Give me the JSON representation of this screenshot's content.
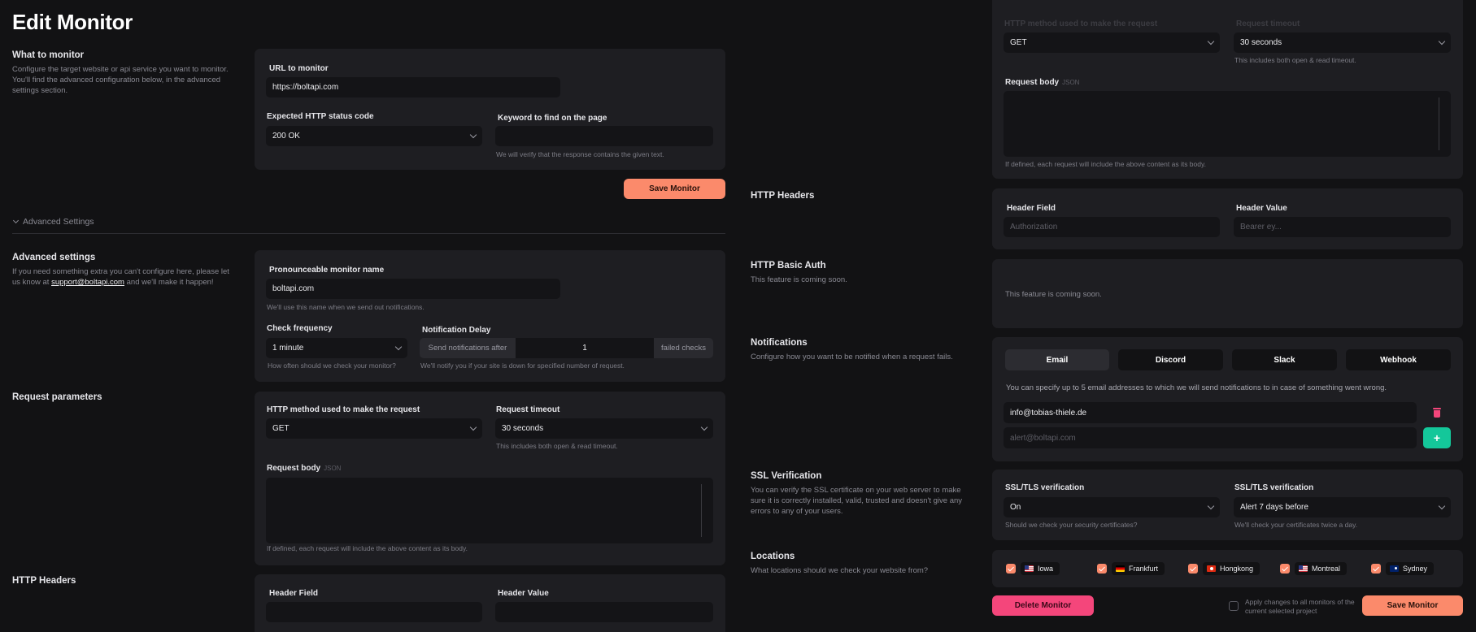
{
  "page": {
    "title": "Edit Monitor"
  },
  "what_to_monitor": {
    "title": "What to monitor",
    "description_lines": [
      "Configure the target website or api service you want to monitor.",
      "You'll find the advanced configuration below, in the advanced",
      "settings section."
    ],
    "url_label": "URL to monitor",
    "url_value": "https://boltapi.com",
    "status_label": "Expected HTTP status code",
    "status_value": "200 OK",
    "keyword_label": "Keyword to find on the page",
    "keyword_value": "",
    "keyword_hint": "We will verify that the response contains the given text."
  },
  "save_button_label": "Save Monitor",
  "advanced_toggle": "Advanced Settings",
  "advanced": {
    "title": "Advanced settings",
    "description_line1": "If you need something extra you can't configure here, please let",
    "description_line2_pre": "us know at ",
    "support_email": "support@boltapi.com",
    "description_line2_post": " and we'll make it happen!",
    "name_label": "Pronounceable monitor name",
    "name_value": "boltapi.com",
    "name_hint": "We'll use this name when we send out notifications.",
    "frequency_label": "Check frequency",
    "frequency_value": "1 minute",
    "frequency_hint": "How often should we check your monitor?",
    "delay_label": "Notification Delay",
    "delay_prefix": "Send notifications after",
    "delay_value": "1",
    "delay_suffix": "failed checks",
    "delay_hint": "We'll notify you if your site is down for specified number of request."
  },
  "request": {
    "title": "Request parameters",
    "method_label": "HTTP method used to make the request",
    "method_value": "GET",
    "timeout_label": "Request timeout",
    "timeout_value": "30 seconds",
    "timeout_hint": "This includes both open & read timeout.",
    "body_label": "Request body",
    "body_tag": "JSON",
    "body_hint": "If defined, each request will include the above content as its body.",
    "right_cut_method_label": "HTTP method used to make the request",
    "right_cut_timeout_label": "Request timeout"
  },
  "headers": {
    "title": "HTTP Headers",
    "field_label": "Header Field",
    "field_placeholder": "Authorization",
    "value_label": "Header Value",
    "value_placeholder": "Bearer ey..."
  },
  "basic_auth": {
    "title": "HTTP Basic Auth",
    "description": "This feature is coming soon.",
    "card_text": "This feature is coming soon."
  },
  "notifications": {
    "title": "Notifications",
    "description": "Configure how you want to be notified when a request fails.",
    "tabs": [
      "Email",
      "Discord",
      "Slack",
      "Webhook"
    ],
    "info": "You can specify up to 5 email addresses to which we will send notifications to in case of something went wrong.",
    "email_value": "info@tobias-thiele.de",
    "email_placeholder": "alert@boltapi.com",
    "add_label": "+"
  },
  "ssl": {
    "title": "SSL Verification",
    "description_lines": [
      "You can verify the SSL certificate on your web server to make",
      "sure it is correctly installed, valid, trusted and doesn't give any",
      "errors to any of your users."
    ],
    "verify_label": "SSL/TLS verification",
    "verify_value": "On",
    "verify_hint": "Should we check your security certificates?",
    "alert_label": "SSL/TLS verification",
    "alert_value": "Alert 7 days before",
    "alert_hint": "We'll check your certificates twice a day."
  },
  "locations": {
    "title": "Locations",
    "description": "What locations should we check your website from?",
    "items": [
      "Iowa",
      "Frankfurt",
      "Hongkong",
      "Montreal",
      "Sydney"
    ]
  },
  "footer": {
    "delete_label": "Delete Monitor",
    "apply_line1": "Apply changes to all monitors of the",
    "apply_line2": "current selected project",
    "save_label": "Save Monitor"
  },
  "colors": {
    "background": "#121214",
    "card": "#1e1e22",
    "accent_orange": "#fb8a6b",
    "accent_pink": "#f4467b",
    "accent_green": "#14c79a"
  }
}
